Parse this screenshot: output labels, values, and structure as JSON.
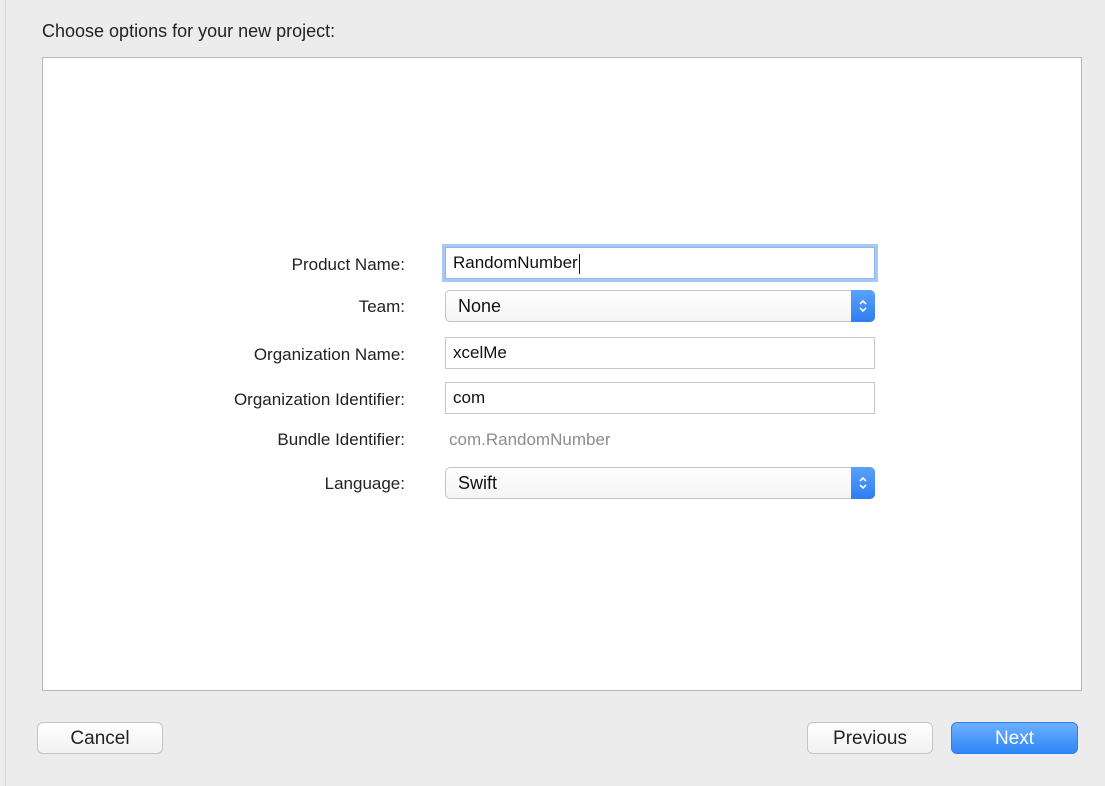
{
  "dialog": {
    "heading": "Choose options for your new project:"
  },
  "form": {
    "product_name": {
      "label": "Product Name:",
      "value": "RandomNumber"
    },
    "team": {
      "label": "Team:",
      "value": "None"
    },
    "organization_name": {
      "label": "Organization Name:",
      "value": "xcelMe"
    },
    "organization_identifier": {
      "label": "Organization Identifier:",
      "value": "com"
    },
    "bundle_identifier": {
      "label": "Bundle Identifier:",
      "value": "com.RandomNumber"
    },
    "language": {
      "label": "Language:",
      "value": "Swift"
    }
  },
  "buttons": {
    "cancel": "Cancel",
    "previous": "Previous",
    "next": "Next"
  },
  "icons": {
    "stepper": "chevron-up-down-icon"
  },
  "colors": {
    "accent": "#2f86f6",
    "focus_ring": "#a7c8f3"
  }
}
